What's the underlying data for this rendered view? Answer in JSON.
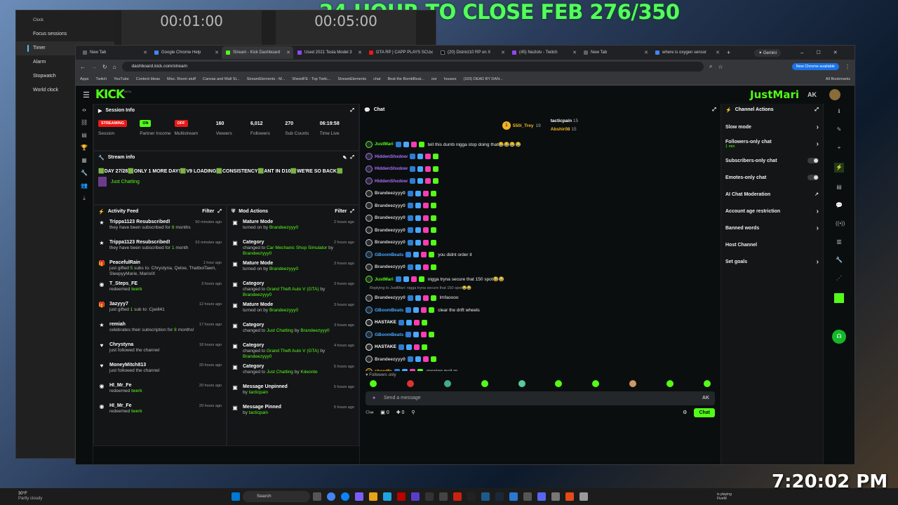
{
  "overlay": {
    "title": "24 HOUR TO CLOSE FEB 276/350",
    "clock": "7:20:02 PM"
  },
  "clock_app": {
    "title": "Clock",
    "nav": [
      "Focus sessions",
      "Timer",
      "Alarm",
      "Stopwatch",
      "World clock"
    ],
    "timers": [
      "00:01:00",
      "00:05:00"
    ]
  },
  "browser": {
    "tabs": [
      {
        "label": "New Tab",
        "color": "#5f6368"
      },
      {
        "label": "Google Chrome Help",
        "color": "#4285f4"
      },
      {
        "label": "Stream - Kick Dashboard",
        "color": "#53fc18"
      },
      {
        "label": "Used 2021 Tesla Model 3",
        "color": "#9146ff"
      },
      {
        "label": "GTA RP | CAPP PLAYS SCU",
        "color": "#e91916"
      },
      {
        "label": "(20) District10 RP on X",
        "color": "#000000"
      },
      {
        "label": "(45) Nezlotv - Twitch",
        "color": "#9146ff"
      },
      {
        "label": "New Tab",
        "color": "#5f6368"
      },
      {
        "label": "where is oxygen sensor",
        "color": "#4285f4"
      }
    ],
    "gemini": "Gemini",
    "url": "dashboard.kick.com/stream",
    "new_chrome": "New Chrome available",
    "bookmarks": [
      "Apps",
      "Twitch",
      "YouTube",
      "Content Ideas",
      "Misc. Room stuff",
      "Canvas and Wall St...",
      "StreamElements - M...",
      "SheedFE - Top Twitc...",
      "StreamElements",
      "chat",
      "Beat the BombBeat...",
      "oor",
      "houses",
      "(103) DEAD BY DAN..."
    ],
    "all_bookmarks": "All Bookmarks"
  },
  "kick": {
    "logo": "KICK",
    "logo_sup": "BETA",
    "user_overlay": "JustMari",
    "session": {
      "title": "Session Info",
      "stats": [
        {
          "value": "STREAMING",
          "label": "Session",
          "pill": "#e91916"
        },
        {
          "value": "ON",
          "label": "Partner Income",
          "pill": "#53fc18"
        },
        {
          "value": "OFF",
          "label": "Multistream",
          "pill": "#e91916"
        },
        {
          "value": "160",
          "label": "Viewers"
        },
        {
          "value": "6,012",
          "label": "Followers"
        },
        {
          "value": "270",
          "label": "Sub Counts"
        },
        {
          "value": "06:19:58",
          "label": "Time Live"
        }
      ]
    },
    "stream_info": {
      "title": "Stream info",
      "text": "🟩DAY 27/28🟩ONLY 1 MORE DAY!🟩V9 LOADING🟩CONSISTENCY🟩ANT IN D10🟩WE'RE SO BACK🟩",
      "category": "Just Chatting"
    },
    "activity": {
      "title": "Activity Feed",
      "filter": "Filter",
      "items": [
        {
          "icon": "★",
          "name": "Trippa1123 Resubscribed!",
          "text": "they have been subscribed for ",
          "hl": "8",
          "text2": " months",
          "time": "50 minutes ago"
        },
        {
          "icon": "★",
          "name": "Trippa1123 Resubscribed!",
          "text": "they have been subscribed for ",
          "hl": "1",
          "text2": " month",
          "time": "53 minutes ago"
        },
        {
          "icon": "🎁",
          "name": "PeacefulRain",
          "text": "just gifted ",
          "hl": "5",
          "text2": " subs to: Chrystyna, Qeloe, ThatboiTawn, SleepyyMarie, MarioIX",
          "time": "1 hour ago"
        },
        {
          "icon": "◉",
          "name": "T_Steps_FE",
          "text": "redeemed ",
          "hl": "twerk",
          "text2": "",
          "time": "3 hours ago"
        },
        {
          "icon": "🎁",
          "name": "3azyyy7",
          "text": "just gifted ",
          "hl": "1",
          "text2": " sub to: Cjwill41",
          "time": "12 hours ago"
        },
        {
          "icon": "★",
          "name": "remiah",
          "text": "celebrates their subscription for ",
          "hl": "8",
          "text2": " months!",
          "time": "17 hours ago"
        },
        {
          "icon": "♥",
          "name": "Chrystyna",
          "text": "just followed the channel",
          "hl": "",
          "text2": "",
          "time": "18 hours ago"
        },
        {
          "icon": "♥",
          "name": "MoneyMitch813",
          "text": "just followed the channel",
          "hl": "",
          "text2": "",
          "time": "20 hours ago"
        },
        {
          "icon": "◉",
          "name": "HI_Mr_Fe",
          "text": "redeemed ",
          "hl": "twerk",
          "text2": "",
          "time": "20 hours ago"
        },
        {
          "icon": "◉",
          "name": "HI_Mr_Fe",
          "text": "redeemed ",
          "hl": "twerk",
          "text2": "",
          "time": "20 hours ago"
        }
      ]
    },
    "mod": {
      "title": "Mod Actions",
      "filter": "Filter",
      "items": [
        {
          "name": "Mature Mode",
          "text": "turned on by ",
          "hl": "",
          "by": "Brandeezyyy0",
          "time": "2 hours ago"
        },
        {
          "name": "Category",
          "text": "changed to ",
          "hl": "Car Mechanic Shop Simulator",
          "by": "Brandeezyyy0",
          "time": "2 hours ago"
        },
        {
          "name": "Mature Mode",
          "text": "turned on by ",
          "hl": "",
          "by": "Brandeezyyy0",
          "time": "3 hours ago"
        },
        {
          "name": "Category",
          "text": "changed to ",
          "hl": "Grand Theft Auto V (GTA)",
          "by": "Brandeezyyy0",
          "time": "3 hours ago"
        },
        {
          "name": "Mature Mode",
          "text": "turned on by ",
          "hl": "",
          "by": "Brandeezyyy0",
          "time": "3 hours ago"
        },
        {
          "name": "Category",
          "text": "changed to ",
          "hl": "Just Chatting",
          "by": "Brandeezyyy0",
          "time": "3 hours ago"
        },
        {
          "name": "Category",
          "text": "changed to ",
          "hl": "Grand Theft Auto V (GTA)",
          "by": "Brandeezyyy0",
          "time": "4 hours ago"
        },
        {
          "name": "Category",
          "text": "changed to ",
          "hl": "Just Chatting",
          "by": "Kdeonte",
          "time": "5 hours ago"
        },
        {
          "name": "Message Unpinned",
          "text": "by ",
          "hl": "",
          "by": "tacticpain",
          "time": "5 hours ago"
        },
        {
          "name": "Message Pinned",
          "text": "by ",
          "hl": "",
          "by": "tacticpain",
          "time": "5 hours ago"
        }
      ]
    },
    "chat": {
      "title": "Chat",
      "top": [
        {
          "name": "550i_Trey",
          "n": "19"
        },
        {
          "name": "tacticpain",
          "n": "15"
        },
        {
          "name": "Abshir08",
          "n": "15"
        }
      ],
      "messages": [
        {
          "user": "JustMari",
          "color": "#53fc18",
          "text": "tell this dumb nigga stop doing that😂😂😂😂"
        },
        {
          "user": "HiddenShxdow",
          "color": "#a970ff",
          "text": ""
        },
        {
          "user": "HiddenShxdow",
          "color": "#a970ff",
          "text": ""
        },
        {
          "user": "HiddenShxdow",
          "color": "#a970ff",
          "text": ""
        },
        {
          "user": "Brandeezyyy0",
          "color": "#cfcfcf",
          "text": ""
        },
        {
          "user": "Brandeezyyy0",
          "color": "#cfcfcf",
          "text": ""
        },
        {
          "user": "Brandeezyyy0",
          "color": "#cfcfcf",
          "text": ""
        },
        {
          "user": "Brandeezyyy0",
          "color": "#cfcfcf",
          "text": ""
        },
        {
          "user": "Brandeezyyy0",
          "color": "#cfcfcf",
          "text": ""
        },
        {
          "user": "GBoomBeats",
          "color": "#4aa8ff",
          "text": "you didnt order it"
        },
        {
          "user": "Brandeezyyy0",
          "color": "#cfcfcf",
          "text": ""
        },
        {
          "user": "JustMari",
          "color": "#53fc18",
          "text": "nigga tryna secure that 150 spot😂😂"
        },
        {
          "user": "Brandeezyyy0",
          "color": "#cfcfcf",
          "text": "lmfaoooo"
        },
        {
          "user": "GBoomBeats",
          "color": "#4aa8ff",
          "text": "clear the drift wheels"
        },
        {
          "user": "HASTAKE",
          "color": "#ffffff",
          "text": ""
        },
        {
          "user": "GBoomBeats",
          "color": "#4aa8ff",
          "text": ""
        },
        {
          "user": "HASTAKE",
          "color": "#ffffff",
          "text": ""
        },
        {
          "user": "Brandeezyyy0",
          "color": "#cfcfcf",
          "text": ""
        },
        {
          "user": "sheedfe",
          "color": "#ffb020",
          "text": "opening mail rn"
        }
      ],
      "reply": "Replying to JustMari: nigga tryna secure that 150 spot😂😂",
      "followers_only": "Followers only",
      "placeholder": "Send a message",
      "send": "Chat",
      "count1": "0",
      "count2": "0"
    },
    "actions": {
      "title": "Channel Actions",
      "items": [
        {
          "label": "Slow mode",
          "type": "chev"
        },
        {
          "label": "Followers-only chat",
          "sub": "1 min",
          "type": "chev"
        },
        {
          "label": "Subscribers-only chat",
          "type": "toggle"
        },
        {
          "label": "Emotes-only chat",
          "type": "toggle"
        },
        {
          "label": "AI Chat Moderation",
          "type": "ext"
        },
        {
          "label": "Account age restriction",
          "type": "chev"
        },
        {
          "label": "Banned words",
          "type": "chev"
        },
        {
          "label": "Host Channel",
          "type": ""
        },
        {
          "label": "Set goals",
          "type": "chev"
        }
      ]
    }
  },
  "taskbar": {
    "weather": "30°F",
    "weather_sub": "Partly cloudy",
    "search": "Search",
    "playing": "is playing",
    "game": "FiveM"
  },
  "colors": {
    "kick_green": "#53fc18",
    "bg": "#0b0e0f",
    "panel": "#141517"
  }
}
